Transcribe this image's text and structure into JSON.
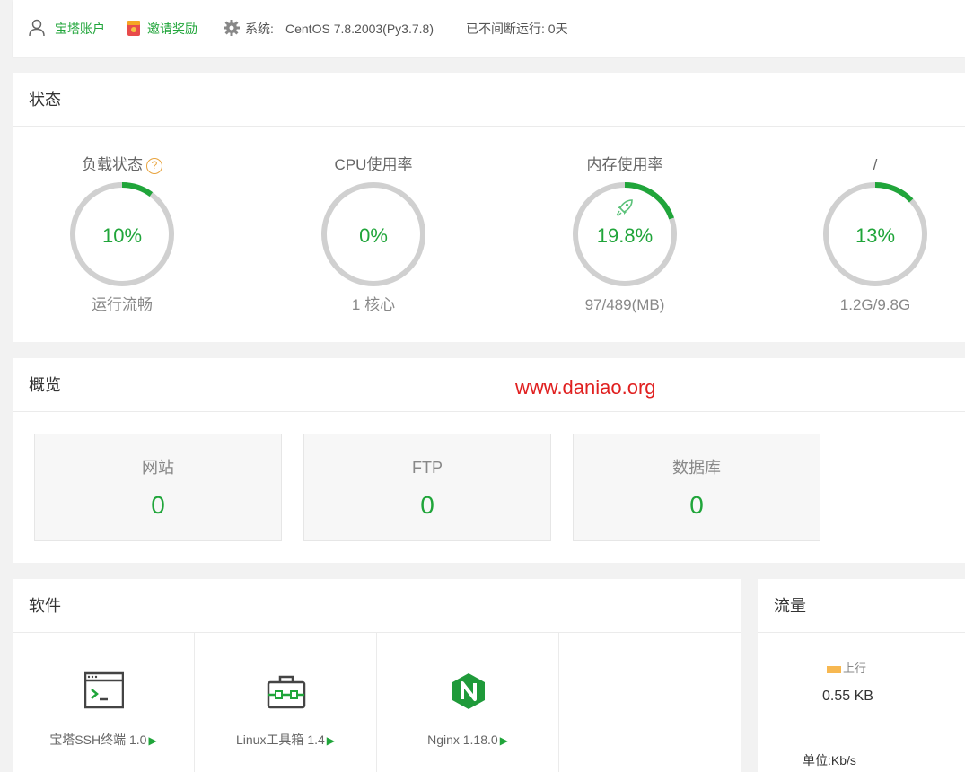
{
  "topbar": {
    "account_label": "宝塔账户",
    "invite_label": "邀请奖励",
    "system_label": "系统:",
    "system_value": "CentOS 7.8.2003(Py3.7.8)",
    "uptime": "已不间断运行: 0天"
  },
  "status": {
    "title": "状态",
    "gauges": [
      {
        "title": "负载状态",
        "value_text": "10%",
        "percent": 10,
        "sub": "运行流畅"
      },
      {
        "title": "CPU使用率",
        "value_text": "0%",
        "percent": 0,
        "sub": "1 核心"
      },
      {
        "title": "内存使用率",
        "value_text": "19.8%",
        "percent": 19.8,
        "sub": "97/489(MB)"
      },
      {
        "title": "/",
        "value_text": "13%",
        "percent": 13,
        "sub": "1.2G/9.8G"
      }
    ]
  },
  "overview": {
    "title": "概览",
    "watermark": "www.daniao.org",
    "boxes": [
      {
        "label": "网站",
        "count": "0"
      },
      {
        "label": "FTP",
        "count": "0"
      },
      {
        "label": "数据库",
        "count": "0"
      }
    ]
  },
  "software": {
    "title": "软件",
    "items": [
      {
        "label": "宝塔SSH终端 1.0",
        "icon": "terminal-icon"
      },
      {
        "label": "Linux工具箱 1.4",
        "icon": "toolbox-icon"
      },
      {
        "label": "Nginx 1.18.0",
        "icon": "nginx-icon"
      }
    ]
  },
  "traffic": {
    "title": "流量",
    "legend_up": "上行",
    "up_value": "0.55 KB",
    "unit": "单位:Kb/s"
  },
  "colors": {
    "accent": "#20a53a",
    "track": "#d0d0d0",
    "warning": "#e8a33d",
    "upload": "#f7b851",
    "watermark": "#e02020"
  }
}
